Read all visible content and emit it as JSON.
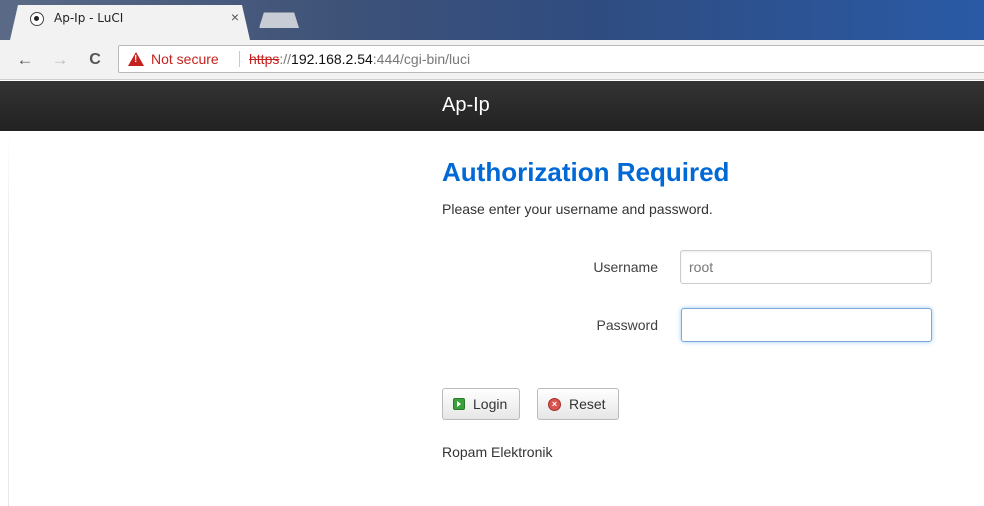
{
  "browser": {
    "tab_title": "Ap-Ip - LuCI",
    "tab_close": "×",
    "back": "←",
    "forward": "→",
    "reload": "C",
    "security_label": "Not secure",
    "url_scheme": "https",
    "url_sep": "://",
    "url_host": "192.168.2.54",
    "url_rest": ":444/cgi-bin/luci"
  },
  "header": {
    "brand": "Ap-Ip"
  },
  "main": {
    "title": "Authorization Required",
    "description": "Please enter your username and password.",
    "username_label": "Username",
    "username_value": "root",
    "password_label": "Password",
    "password_value": ""
  },
  "buttons": {
    "login": "Login",
    "reset": "Reset"
  },
  "footer": {
    "text": "Ropam Elektronik"
  },
  "colors": {
    "title": "#0069d6",
    "header_bg": "#222222",
    "not_secure": "#c5221f"
  }
}
